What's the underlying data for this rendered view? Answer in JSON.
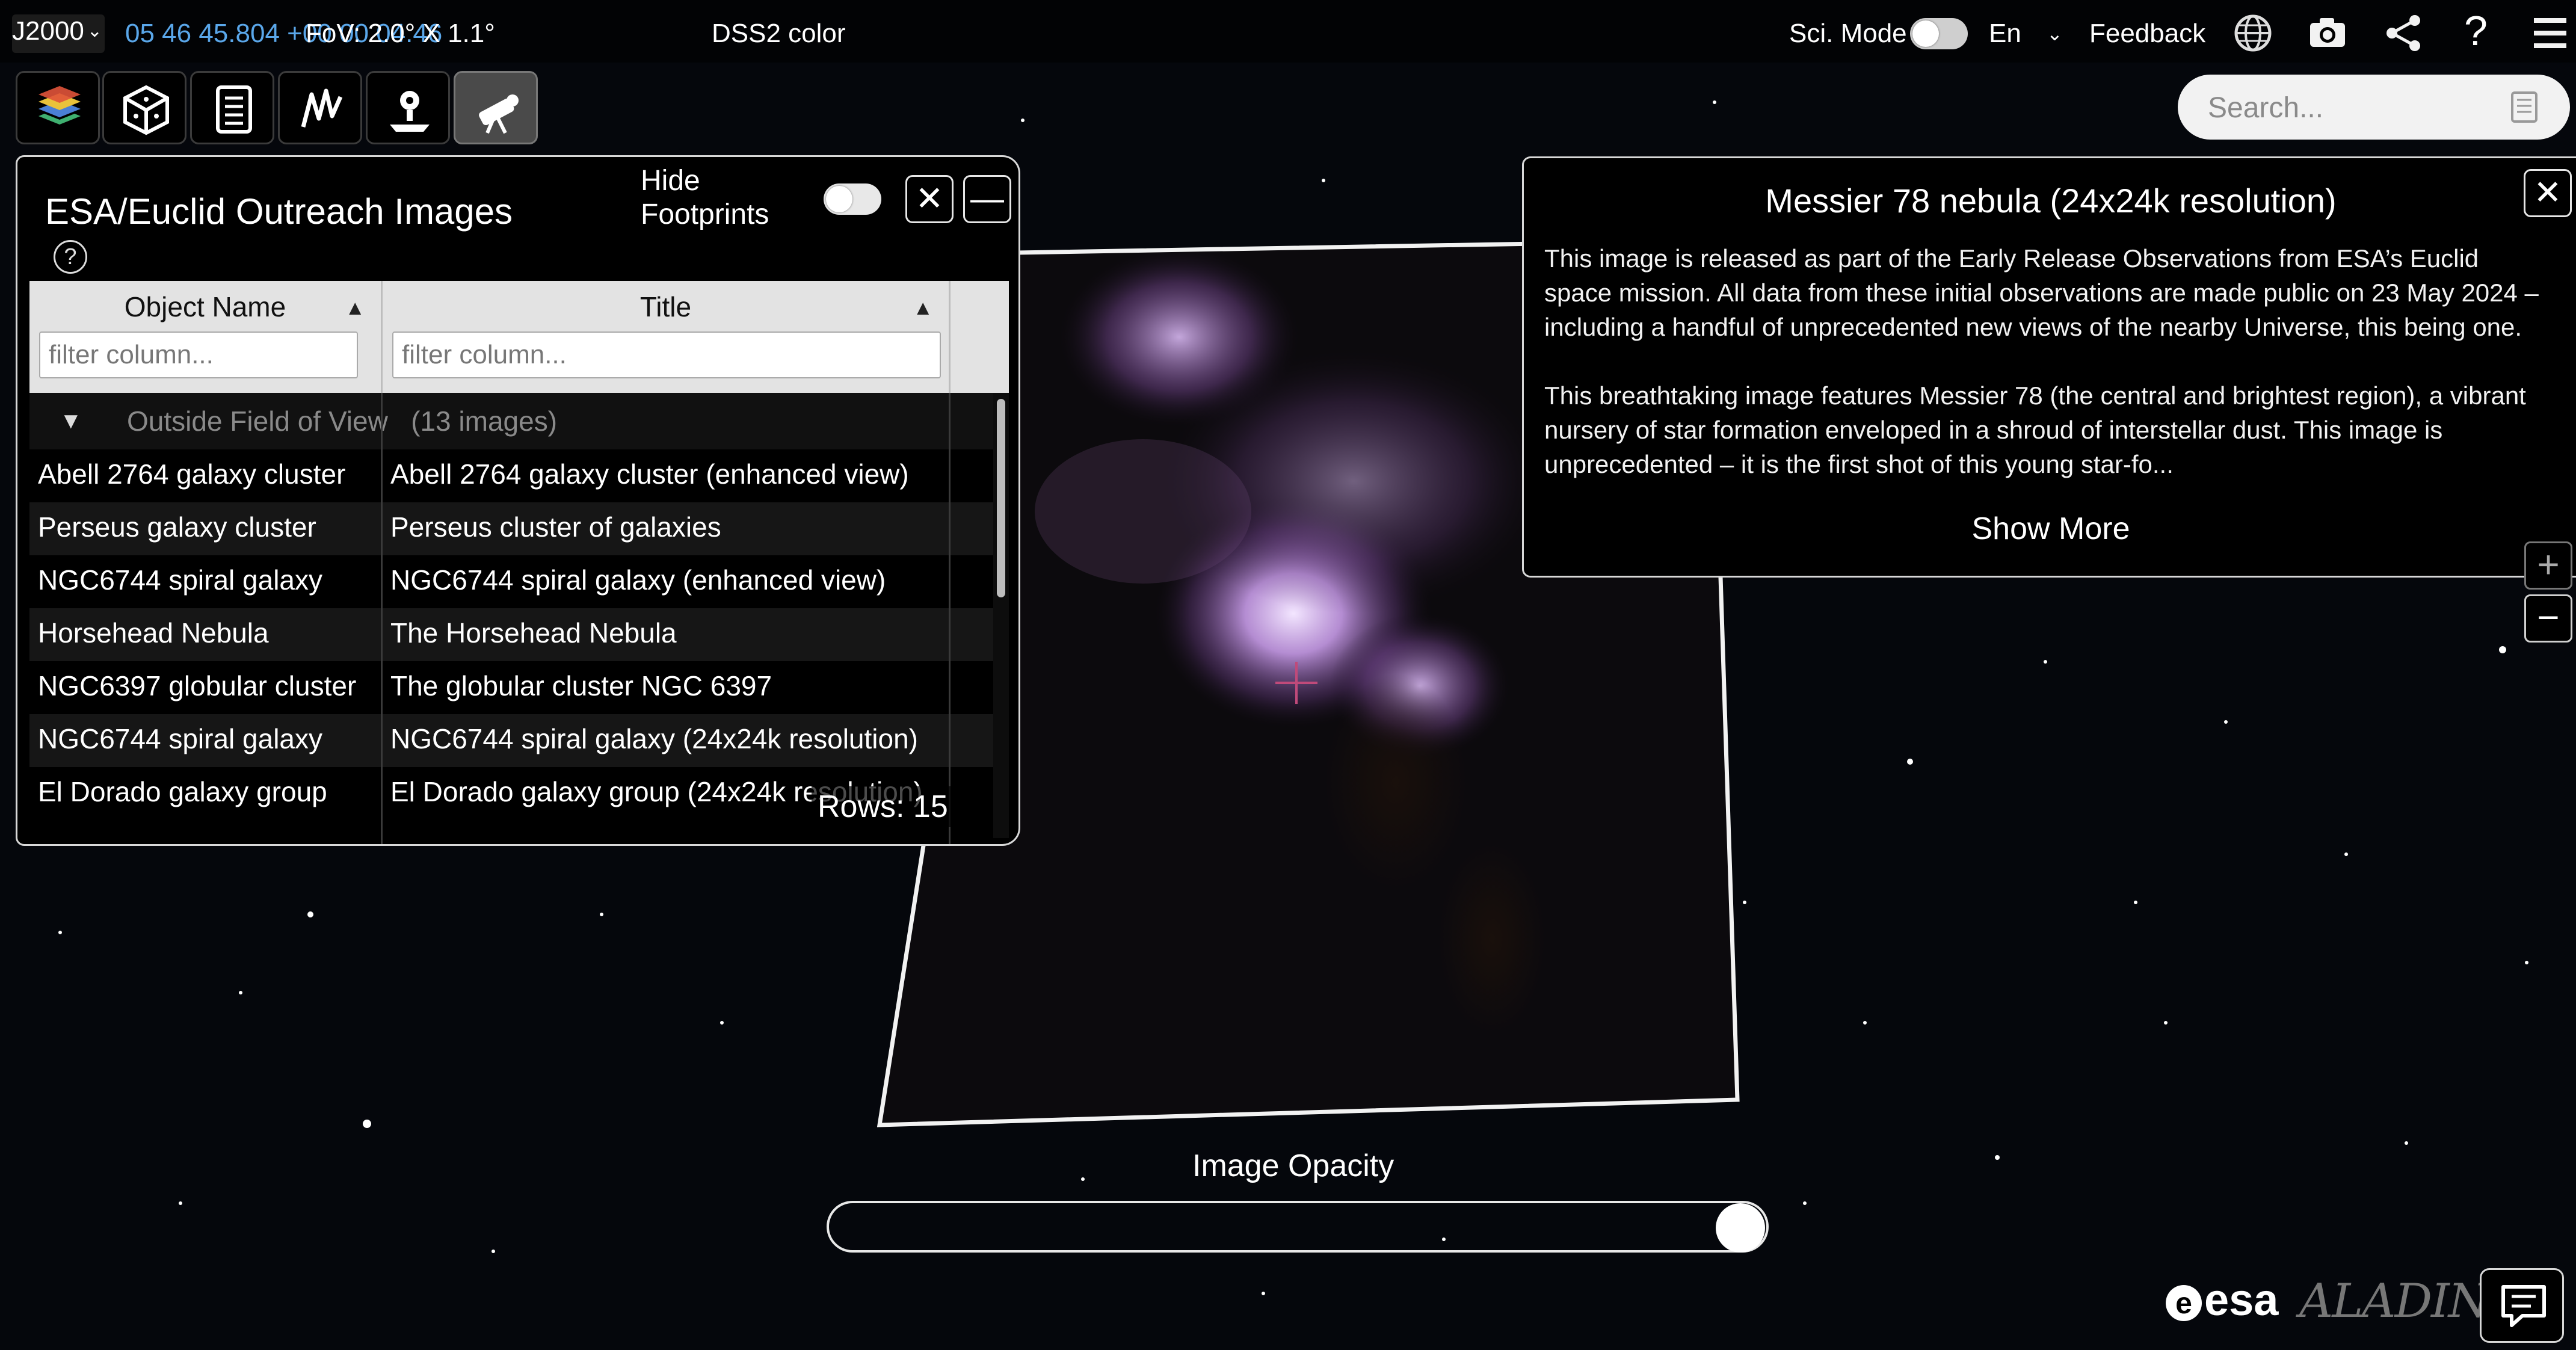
{
  "topbar": {
    "frame": "J2000",
    "coordinates": "05 46 45.804 +00 00 04.46",
    "fov": "FoV: 2.0° X 1.1°",
    "survey": "DSS2 color",
    "sci_mode_label": "Sci. Mode",
    "sci_mode_on": false,
    "language": "En",
    "feedback": "Feedback",
    "icons": [
      "globe-icon",
      "camera-icon",
      "share-icon",
      "help-icon",
      "menu-icon"
    ]
  },
  "toolbar": {
    "tools": [
      "layers-icon",
      "cube-icon",
      "catalog-icon",
      "spectra-icon",
      "mission-icon",
      "outreach-telescope-icon"
    ],
    "active_tool": "outreach-telescope-icon"
  },
  "search": {
    "placeholder": "Search..."
  },
  "panel": {
    "title": "ESA/Euclid Outreach Images",
    "hide_footprints_label": "Hide Footprints",
    "hide_footprints_on": false,
    "columns": [
      {
        "header": "Object Name",
        "filter_placeholder": "filter column..."
      },
      {
        "header": "Title",
        "filter_placeholder": "filter column..."
      }
    ],
    "group": {
      "label": "Outside Field of View",
      "count": "(13 images)"
    },
    "rows": [
      {
        "name": "Abell 2764 galaxy cluster",
        "title": "Abell 2764 galaxy cluster (enhanced view)"
      },
      {
        "name": "Perseus galaxy cluster",
        "title": "Perseus cluster of galaxies"
      },
      {
        "name": "NGC6744 spiral galaxy",
        "title": "NGC6744 spiral galaxy (enhanced view)"
      },
      {
        "name": "Horsehead Nebula",
        "title": "The Horsehead Nebula"
      },
      {
        "name": "NGC6397 globular cluster",
        "title": "The globular cluster NGC 6397"
      },
      {
        "name": "NGC6744 spiral galaxy",
        "title": "NGC6744 spiral galaxy (24x24k resolution)"
      },
      {
        "name": "El Dorado galaxy group",
        "title": "El Dorado galaxy group (24x24k resolution)"
      }
    ],
    "rows_count": "Rows: 15"
  },
  "info": {
    "title": "Messier 78 nebula (24x24k resolution)",
    "paragraph1": "This image is released as part of the Early Release Observations from ESA’s Euclid space mission. All data from these initial observations are made public on 23 May 2024 – including a handful of unprecedented new views of the nearby Universe, this being one.",
    "paragraph2": "This breathtaking image features Messier 78 (the central and brightest region), a vibrant nursery of star formation enveloped in a shroud of interstellar dust. This image is unprecedented – it is the first shot of this young star-fo...",
    "show_more": "Show More"
  },
  "zoom": {
    "in": "+",
    "out": "−"
  },
  "opacity": {
    "label": "Image Opacity",
    "value": 1.0
  },
  "branding": {
    "esa": "esa",
    "aladin": "ALADIN"
  },
  "colors": {
    "coords": "#5aa7ea",
    "nebula": "#c89ae6",
    "panel_bg": "#000000"
  }
}
